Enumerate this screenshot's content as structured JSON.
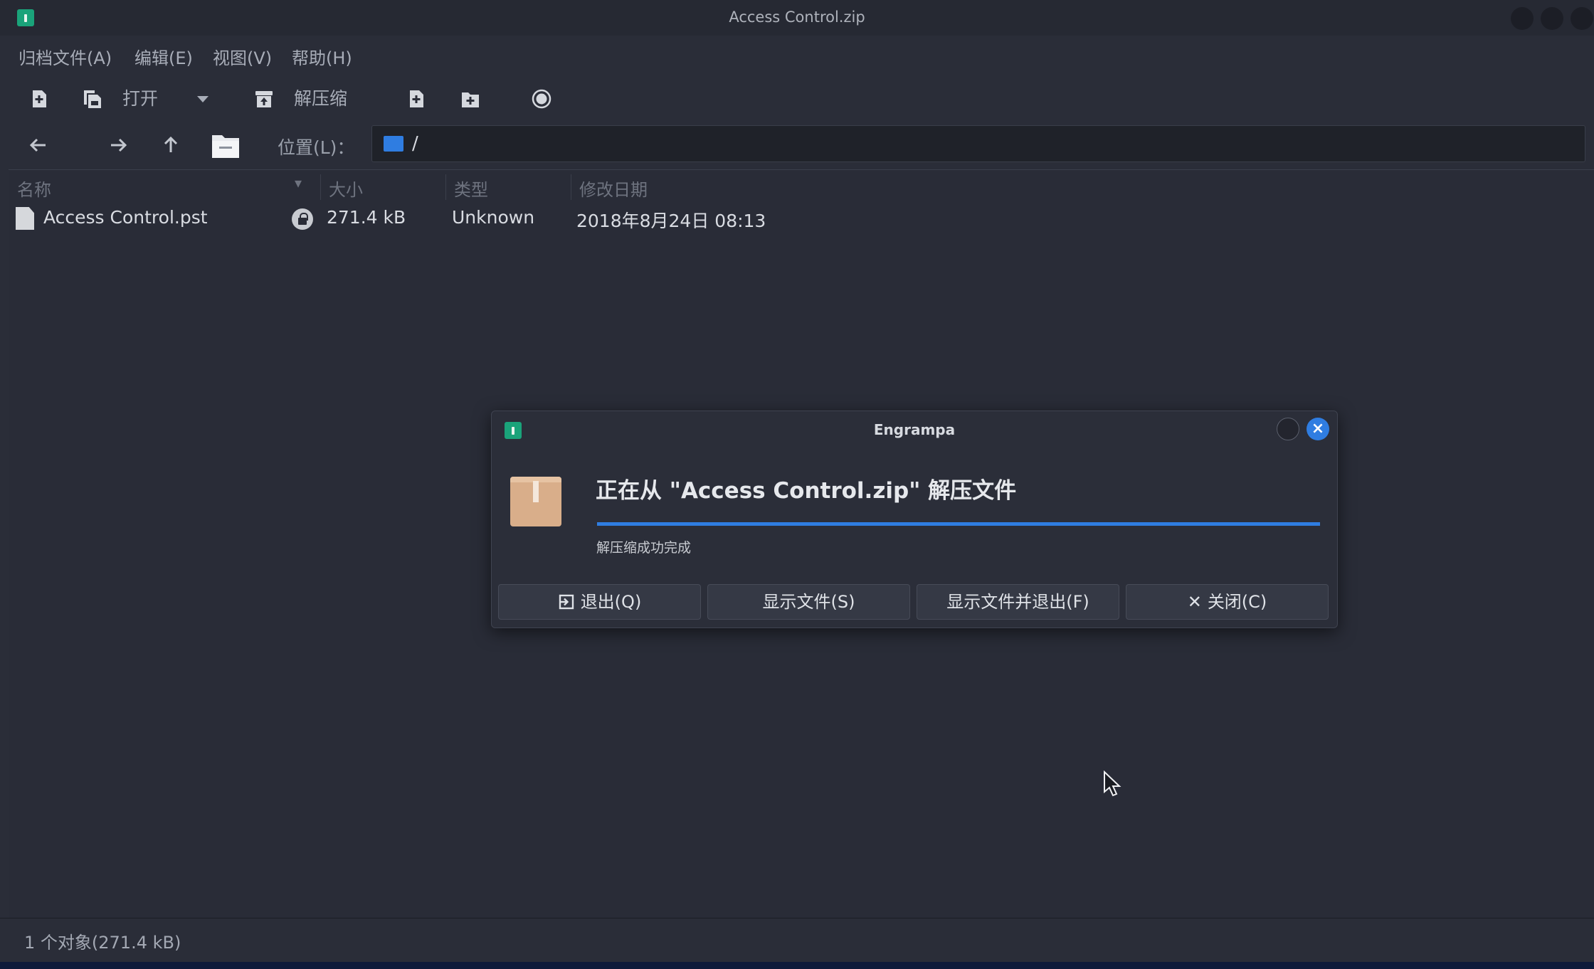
{
  "window": {
    "title": "Access Control.zip"
  },
  "menu": [
    {
      "label": "归档文件(A)"
    },
    {
      "label": "编辑(E)"
    },
    {
      "label": "视图(V)"
    },
    {
      "label": "帮助(H)"
    }
  ],
  "toolbar": {
    "open_label": "打开",
    "extract_label": "解压缩"
  },
  "location": {
    "label": "位置(L)：",
    "path": "/"
  },
  "columns": {
    "name": "名称",
    "size": "大小",
    "type": "类型",
    "modified": "修改日期"
  },
  "files": [
    {
      "name": "Access Control.pst",
      "size": "271.4 kB",
      "type": "Unknown",
      "modified": "2018年8月24日 08:13"
    }
  ],
  "status": {
    "text": "1 个对象(271.4 kB)"
  },
  "dialog": {
    "title": "Engrampa",
    "heading": "正在从 \"Access Control.zip\" 解压文件",
    "progress": 1.0,
    "status": "解压缩成功完成",
    "buttons": {
      "quit": "退出(Q)",
      "show_files": "显示文件(S)",
      "show_and_quit": "显示文件并退出(F)",
      "close": "关闭(C)"
    }
  },
  "colors": {
    "accent": "#2f7de1",
    "app_icon": "#1aa37a",
    "background": "#2a2d38"
  }
}
